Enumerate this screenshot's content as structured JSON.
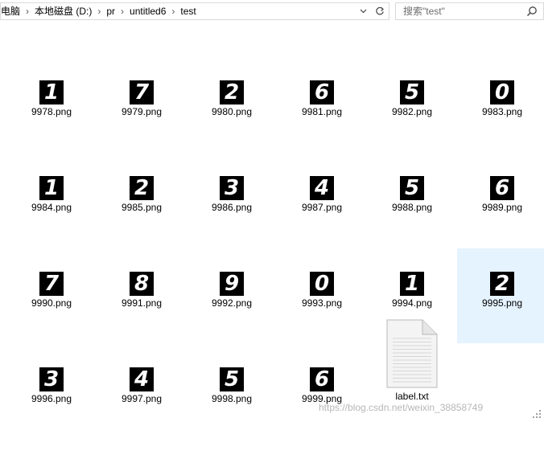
{
  "address": {
    "crumbs": [
      "电脑",
      "本地磁盘 (D:)",
      "pr",
      "untitled6",
      "test"
    ]
  },
  "search": {
    "placeholder": "搜索\"test\""
  },
  "files": [
    {
      "name": "9978.png",
      "digit": "1"
    },
    {
      "name": "9979.png",
      "digit": "7"
    },
    {
      "name": "9980.png",
      "digit": "2"
    },
    {
      "name": "9981.png",
      "digit": "6"
    },
    {
      "name": "9982.png",
      "digit": "5"
    },
    {
      "name": "9983.png",
      "digit": "0"
    },
    {
      "name": "9984.png",
      "digit": "1"
    },
    {
      "name": "9985.png",
      "digit": "2"
    },
    {
      "name": "9986.png",
      "digit": "3"
    },
    {
      "name": "9987.png",
      "digit": "4"
    },
    {
      "name": "9988.png",
      "digit": "5"
    },
    {
      "name": "9989.png",
      "digit": "6"
    },
    {
      "name": "9990.png",
      "digit": "7"
    },
    {
      "name": "9991.png",
      "digit": "8"
    },
    {
      "name": "9992.png",
      "digit": "9"
    },
    {
      "name": "9993.png",
      "digit": "0"
    },
    {
      "name": "9994.png",
      "digit": "1"
    },
    {
      "name": "9995.png",
      "digit": "2",
      "selected": true
    },
    {
      "name": "9996.png",
      "digit": "3"
    },
    {
      "name": "9997.png",
      "digit": "4"
    },
    {
      "name": "9998.png",
      "digit": "5"
    },
    {
      "name": "9999.png",
      "digit": "6"
    },
    {
      "name": "label.txt",
      "type": "txt"
    }
  ],
  "watermark": "https://blog.csdn.net/weixin_38858749",
  "colors": {
    "selection": "#e5f3ff",
    "thumb_bg": "#000000"
  }
}
